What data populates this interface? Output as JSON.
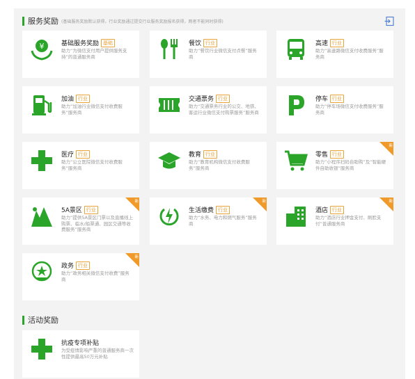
{
  "service": {
    "title": "服务奖励",
    "note": "(基础服务奖励默认获得，行业奖励通过提交行业服务奖励报名获得，两者不能同时获得)",
    "exit_icon": "exit-icon",
    "cards": [
      {
        "name": "基础服务奖励",
        "tag": "基础",
        "desc": "助力“为微信支付用户提供服务支持”的普通服务商",
        "icon": "yuan-hands-icon",
        "new": false
      },
      {
        "name": "餐饮",
        "tag": "行业",
        "desc": "助力“餐饮行业微信支付点餐”服务商",
        "icon": "fork-spoon-icon",
        "new": false
      },
      {
        "name": "高速",
        "tag": "行业",
        "desc": "助力“高速路微信支付收费服务”服务商",
        "icon": "bus-icon",
        "new": false
      },
      {
        "name": "加油",
        "tag": "行业",
        "desc": "助力“加油行业微信支付收费服务”服务商",
        "icon": "fuel-pump-icon",
        "new": false
      },
      {
        "name": "交通票务",
        "tag": "行业",
        "desc": "助力“交通票务行业的公交、地铁、客运行业微信支付购票服务”服务商",
        "icon": "ticket-icon",
        "new": false
      },
      {
        "name": "停车",
        "tag": "行业",
        "desc": "助力“停车场微信支付收费服务”服务商",
        "icon": "parking-icon",
        "new": false
      },
      {
        "name": "医疗",
        "tag": "行业",
        "desc": "助力“公立医院微信支付收费服务”服务商",
        "icon": "medical-cross-icon",
        "new": false
      },
      {
        "name": "教育",
        "tag": "行业",
        "desc": "助力“教育机构微信支付收费服务”服务商",
        "icon": "graduation-cap-icon",
        "new": false
      },
      {
        "name": "零售",
        "tag": "行业",
        "desc": "助力“小程序扫码自助购”及“智能硬件自助收银”服务商",
        "icon": "shopping-cart-icon",
        "new": true
      },
      {
        "name": "5A景区",
        "tag": "行业",
        "desc": "助力“提供5A景区门票以及直播线上购票、临水/船票通、园区交通等收费服务”服务商",
        "icon": "mountain-icon",
        "new": true
      },
      {
        "name": "生活缴费",
        "tag": "行业",
        "desc": "助力“水务、电力和燃气服务”服务商",
        "icon": "power-icon",
        "new": true
      },
      {
        "name": "酒店",
        "tag": "行业",
        "desc": "助力“酒店行业押金支付、刷脸支付”普通服务商",
        "icon": "building-icon",
        "new": true
      },
      {
        "name": "政务",
        "tag": "行业",
        "desc": "助力“政务相关微信支付收费”服务商",
        "icon": "government-badge-icon",
        "new": true
      }
    ]
  },
  "activity": {
    "title": "活动奖励",
    "cards": [
      {
        "name": "抗疫专项补贴",
        "desc": "为受疫情影响严重的普通服务商一次性提供最高50万元补贴",
        "icon": "medical-cross-icon"
      }
    ]
  },
  "badge_text": "新",
  "colors": {
    "accent": "#2aa52a",
    "tag": "#e8a33b",
    "new_badge": "#f09a2a"
  }
}
